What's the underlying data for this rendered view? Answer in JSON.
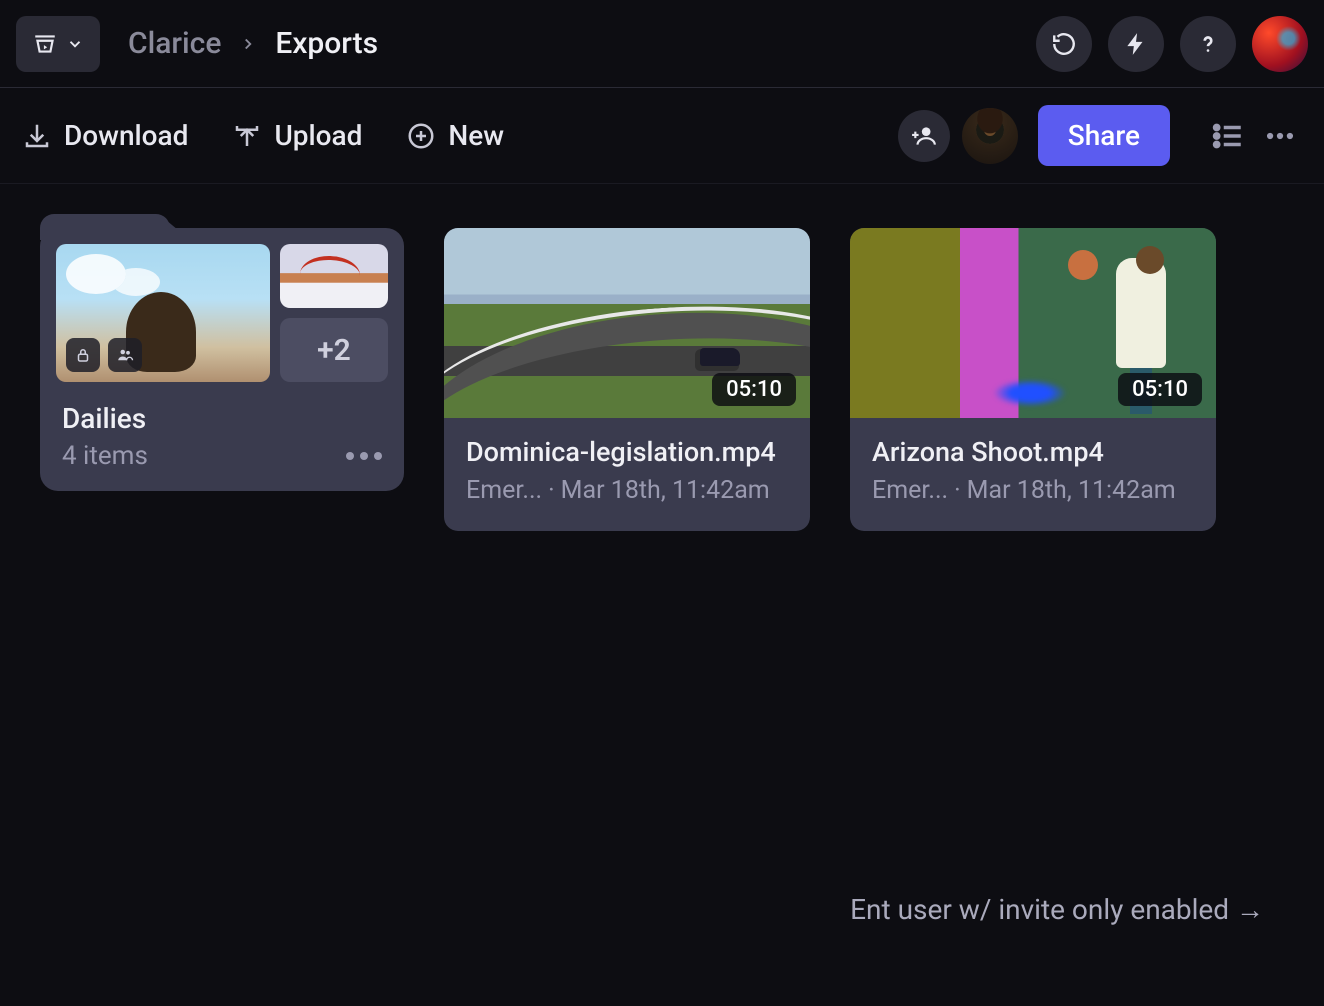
{
  "breadcrumb": {
    "parent": "Clarice",
    "current": "Exports"
  },
  "actions": {
    "download": "Download",
    "upload": "Upload",
    "new": "New",
    "share": "Share"
  },
  "folder": {
    "name": "Dailies",
    "subtitle": "4 items",
    "more_count": "+2"
  },
  "videos": [
    {
      "title": "Dominica-legislation.mp4",
      "uploader": "Emer...",
      "timestamp": "Mar 18th, 11:42am",
      "duration": "05:10"
    },
    {
      "title": "Arizona Shoot.mp4",
      "uploader": "Emer...",
      "timestamp": "Mar 18th, 11:42am",
      "duration": "05:10"
    }
  ],
  "footer_note": "Ent user w/ invite only enabled →"
}
